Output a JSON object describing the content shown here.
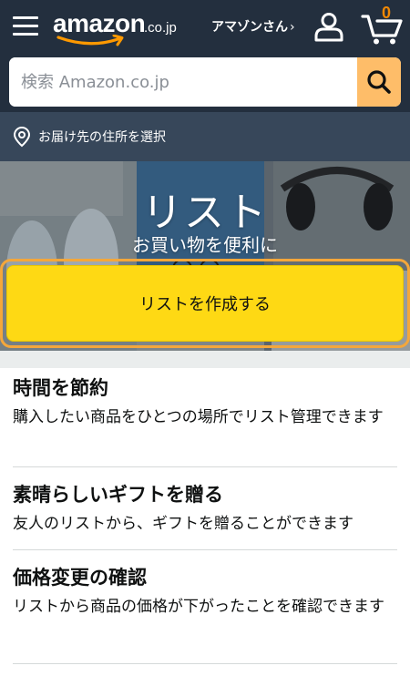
{
  "header": {
    "logo_text": "amazon",
    "logo_tld": ".co.jp",
    "account_label": "アマゾンさん",
    "account_chevron": "›",
    "cart_count": "0",
    "icons": [
      "menu-icon",
      "user-icon",
      "cart-icon",
      "search-icon",
      "location-pin-icon"
    ]
  },
  "search": {
    "placeholder": "検索 Amazon.co.jp",
    "value": ""
  },
  "delivery": {
    "label": "お届け先の住所を選択"
  },
  "hero": {
    "title": "リスト",
    "subtitle": "お買い物を便利に",
    "button_label": "リストを作成する"
  },
  "features": [
    {
      "title": "時間を節約",
      "description": "購入したい商品をひとつの場所でリスト管理できます"
    },
    {
      "title": "素晴らしいギフトを贈る",
      "description": "友人のリストから、ギフトを贈ることができます"
    },
    {
      "title": "価格変更の確認",
      "description": "リストから商品の価格が下がったことを確認できます"
    }
  ],
  "colors": {
    "header_bg": "#232f3e",
    "delivery_bg": "#37475a",
    "search_button": "#febd69",
    "primary_button": "#fed914",
    "focus_ring": "#f4a73b",
    "cart_count": "#f08804"
  }
}
